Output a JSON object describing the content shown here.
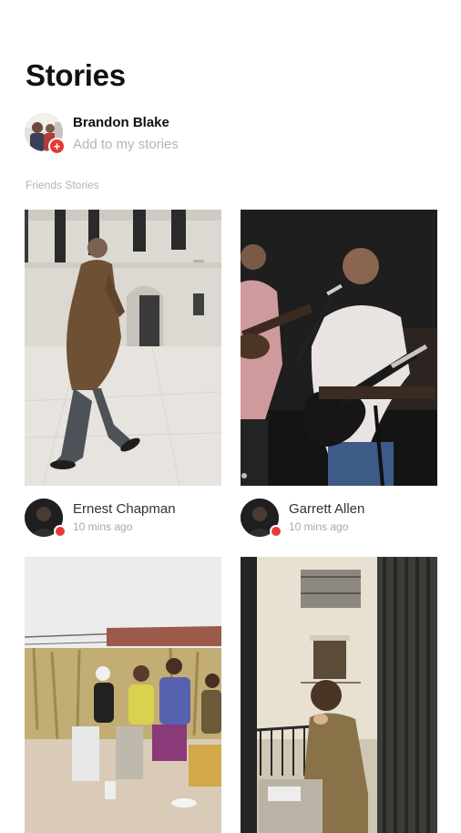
{
  "page": {
    "title": "Stories"
  },
  "me": {
    "name": "Brandon Blake",
    "subtitle": "Add to my stories",
    "badge": "+"
  },
  "friends": {
    "section_label": "Friends Stories",
    "stories": [
      {
        "name": "Ernest Chapman",
        "time": "10 mins ago"
      },
      {
        "name": "Garrett Allen",
        "time": "10 mins ago"
      }
    ]
  },
  "colors": {
    "accent": "#e53935",
    "muted_text": "#b5b5b5"
  }
}
